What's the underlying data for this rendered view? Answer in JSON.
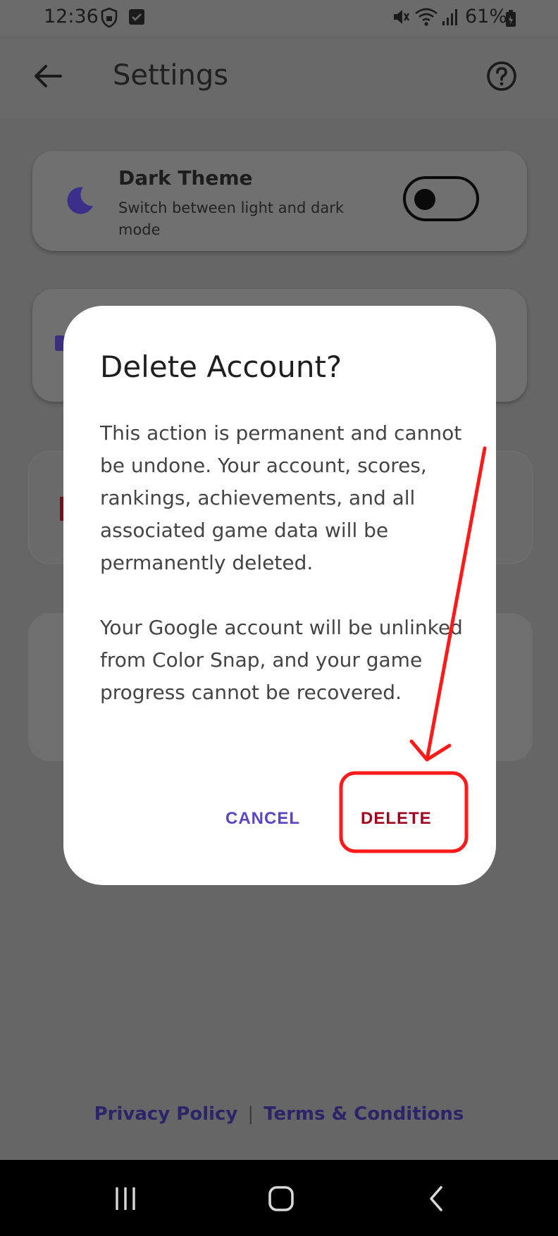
{
  "status_bar": {
    "time": "12:36",
    "battery_text": "61%",
    "icons": [
      "shield-icon",
      "checkbox-notification-icon",
      "mute-icon",
      "wifi-icon",
      "signal-icon",
      "battery-icon"
    ]
  },
  "app_bar": {
    "title": "Settings",
    "icons": [
      "back-arrow-icon",
      "help-icon"
    ]
  },
  "dark_theme_card": {
    "title": "Dark Theme",
    "subtitle": "Switch between light and dark mode",
    "icon": "moon-icon",
    "toggle_on": false
  },
  "dialog": {
    "title": "Delete Account?",
    "body_paragraph_1": "This action is permanent and cannot be undone. Your account, scores, rankings, achievements, and all associated game data will be permanently deleted.",
    "body_paragraph_2": "Your Google account will be unlinked from Color Snap, and your game progress cannot be recovered.",
    "cancel_label": "CANCEL",
    "delete_label": "DELETE"
  },
  "footer": {
    "privacy_label": "Privacy Policy",
    "separator": "|",
    "terms_label": "Terms & Conditions"
  },
  "nav_bar": {
    "icons": [
      "recent-apps-icon",
      "home-icon",
      "back-icon"
    ]
  },
  "colors": {
    "scrim": "#696969",
    "dialog_bg": "#ffffff",
    "cancel_text": "#5b45c3",
    "delete_text": "#a0071f",
    "annotation": "#ff1a1a",
    "footer_link": "#2c2468"
  }
}
